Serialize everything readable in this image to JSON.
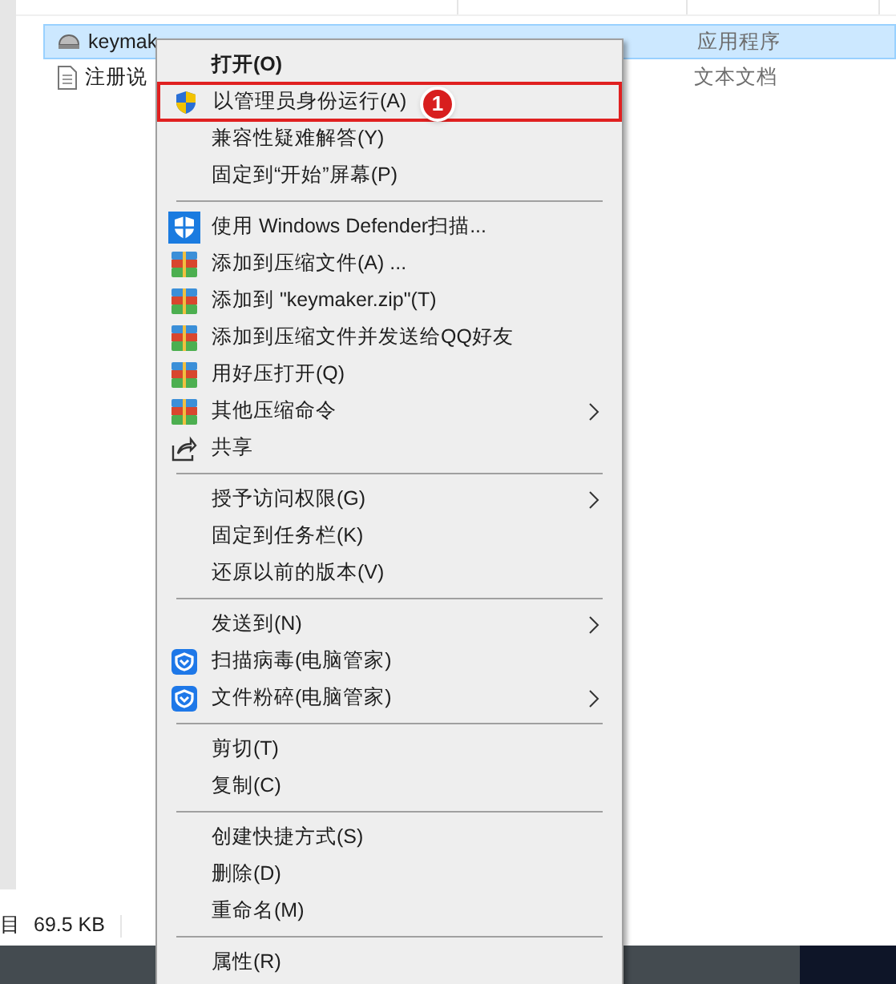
{
  "files": [
    {
      "name": "keymak",
      "type": "应用程序",
      "kind": "app",
      "selected": true
    },
    {
      "name": "注册说",
      "type": "文本文档",
      "kind": "doc",
      "selected": false
    }
  ],
  "status_bar": {
    "count_label": "目",
    "size": "69.5 KB"
  },
  "context_menu": {
    "groups": [
      [
        {
          "label": "打开(O)",
          "bold": true,
          "submenu": false
        },
        {
          "label": "以管理员身份运行(A)",
          "kind": "uac",
          "bold": false,
          "submenu": false,
          "highlighted": true,
          "badge": "1"
        },
        {
          "label": "兼容性疑难解答(Y)",
          "bold": false,
          "submenu": false
        },
        {
          "label": "固定到“开始”屏幕(P)",
          "bold": false,
          "submenu": false
        }
      ],
      [
        {
          "label": "使用 Windows Defender扫描...",
          "kind": "defender",
          "bold": false,
          "submenu": false
        },
        {
          "label": "添加到压缩文件(A) ...",
          "kind": "archive",
          "bold": false,
          "submenu": false
        },
        {
          "label": "添加到 \"keymaker.zip\"(T)",
          "kind": "archive",
          "bold": false,
          "submenu": false
        },
        {
          "label": "添加到压缩文件并发送给QQ好友",
          "kind": "archive",
          "bold": false,
          "submenu": false
        },
        {
          "label": "用好压打开(Q)",
          "kind": "archive",
          "bold": false,
          "submenu": false
        },
        {
          "label": "其他压缩命令",
          "kind": "archive",
          "bold": false,
          "submenu": true
        },
        {
          "label": "共享",
          "kind": "share",
          "bold": false,
          "submenu": false
        }
      ],
      [
        {
          "label": "授予访问权限(G)",
          "bold": false,
          "submenu": true
        },
        {
          "label": "固定到任务栏(K)",
          "bold": false,
          "submenu": false
        },
        {
          "label": "还原以前的版本(V)",
          "bold": false,
          "submenu": false
        }
      ],
      [
        {
          "label": "发送到(N)",
          "bold": false,
          "submenu": true
        },
        {
          "label": "扫描病毒(电脑管家)",
          "kind": "guard",
          "bold": false,
          "submenu": false
        },
        {
          "label": "文件粉碎(电脑管家)",
          "kind": "guard",
          "bold": false,
          "submenu": true
        }
      ],
      [
        {
          "label": "剪切(T)",
          "bold": false,
          "submenu": false
        },
        {
          "label": "复制(C)",
          "bold": false,
          "submenu": false
        }
      ],
      [
        {
          "label": "创建快捷方式(S)",
          "bold": false,
          "submenu": false
        },
        {
          "label": "删除(D)",
          "bold": false,
          "submenu": false
        },
        {
          "label": "重命名(M)",
          "bold": false,
          "submenu": false
        }
      ],
      [
        {
          "label": "属性(R)",
          "bold": false,
          "submenu": false
        }
      ]
    ]
  }
}
